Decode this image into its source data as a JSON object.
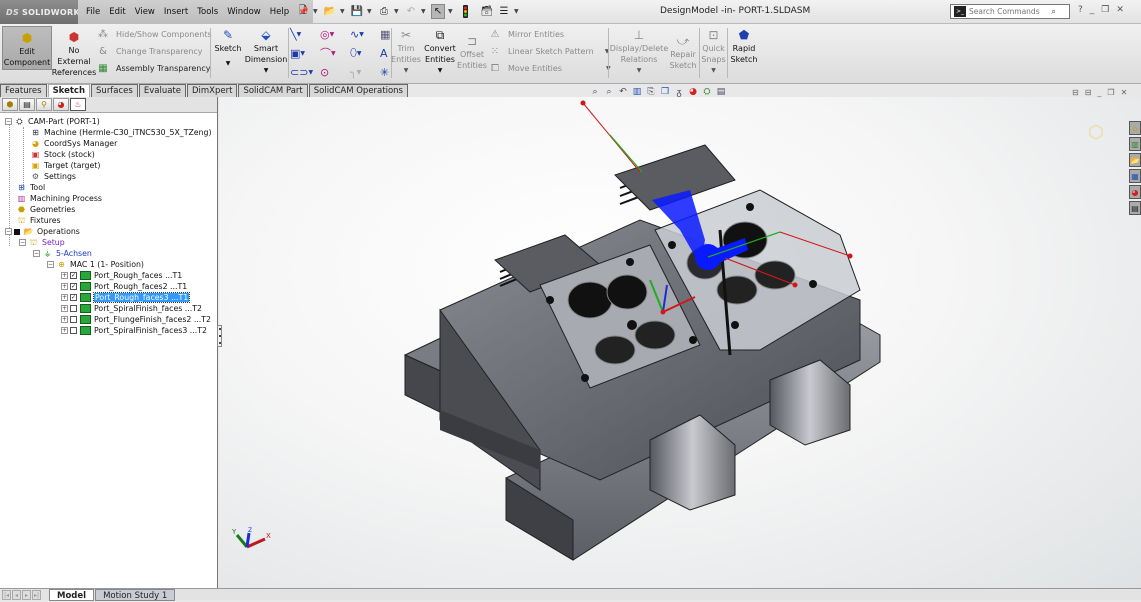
{
  "app": {
    "logo": "SOLIDWORKS",
    "logo_mark": "DS",
    "document_title": "DesignModel -in- PORT-1.SLDASM",
    "menu": [
      "File",
      "Edit",
      "View",
      "Insert",
      "Tools",
      "Window",
      "Help"
    ],
    "search": {
      "placeholder": "Search Commands",
      "value": ""
    }
  },
  "ribbon": {
    "edit_component": {
      "line1": "Edit",
      "line2": "Component"
    },
    "no_external_refs": {
      "line1": "No",
      "line2": "External",
      "line3": "References"
    },
    "hide_show_components": "Hide/Show Components",
    "change_transparency": "Change Transparency",
    "assembly_transparency": "Assembly Transparency",
    "sketch": "Sketch",
    "smart_dimension": {
      "line1": "Smart",
      "line2": "Dimension"
    },
    "trim_entities": {
      "line1": "Trim",
      "line2": "Entities"
    },
    "convert_entities": {
      "line1": "Convert",
      "line2": "Entities"
    },
    "offset_entities": {
      "line1": "Offset",
      "line2": "Entities"
    },
    "mirror_entities": "Mirror Entities",
    "linear_sketch_pattern": "Linear Sketch Pattern",
    "move_entities": "Move Entities",
    "display_delete_relations": {
      "line1": "Display/Delete",
      "line2": "Relations"
    },
    "repair_sketch": {
      "line1": "Repair",
      "line2": "Sketch"
    },
    "quick_snaps": {
      "line1": "Quick",
      "line2": "Snaps"
    },
    "rapid_sketch": {
      "line1": "Rapid",
      "line2": "Sketch"
    }
  },
  "command_tabs": [
    "Features",
    "Sketch",
    "Surfaces",
    "Evaluate",
    "DimXpert",
    "SolidCAM Part",
    "SolidCAM Operations"
  ],
  "active_command_tab": "Sketch",
  "tree": {
    "root": "CAM-Part (PORT-1)",
    "machine": "Machine (Hermle-C30_iTNC530_5X_TZeng)",
    "coordsys": "CoordSys Manager",
    "stock": "Stock (stock)",
    "target": "Target (target)",
    "settings": "Settings",
    "tool": "Tool",
    "machining_process": "Machining Process",
    "geometries": "Geometries",
    "fixtures": "Fixtures",
    "operations": "Operations",
    "setup": "Setup",
    "achsen": "5-Achsen",
    "mac": "MAC 1 (1- Position)",
    "ops": [
      {
        "name": "Port_Rough_faces ...T1",
        "checked": true,
        "selected": false
      },
      {
        "name": "Port_Rough_faces2 ...T1",
        "checked": true,
        "selected": false
      },
      {
        "name": "Port_Rough_faces3 ...T1",
        "checked": true,
        "selected": true
      },
      {
        "name": "Port_SpiralFinish_faces ...T2",
        "checked": false,
        "selected": false
      },
      {
        "name": "Port_FlungeFinish_faces2 ...T2",
        "checked": false,
        "selected": false
      },
      {
        "name": "Port_SpiralFinish_faces3 ...T2",
        "checked": false,
        "selected": false
      }
    ]
  },
  "triad": {
    "x": "X",
    "y": "Y",
    "z": "Z"
  },
  "bottom_tabs": [
    "Model",
    "Motion Study 1"
  ],
  "active_bottom_tab": "Model",
  "colors": {
    "axis_x": "#d01818",
    "axis_y": "#1fae1f",
    "axis_z": "#1a2ed8",
    "toolpath": "#0a1aff",
    "selection": "#3399ff"
  }
}
